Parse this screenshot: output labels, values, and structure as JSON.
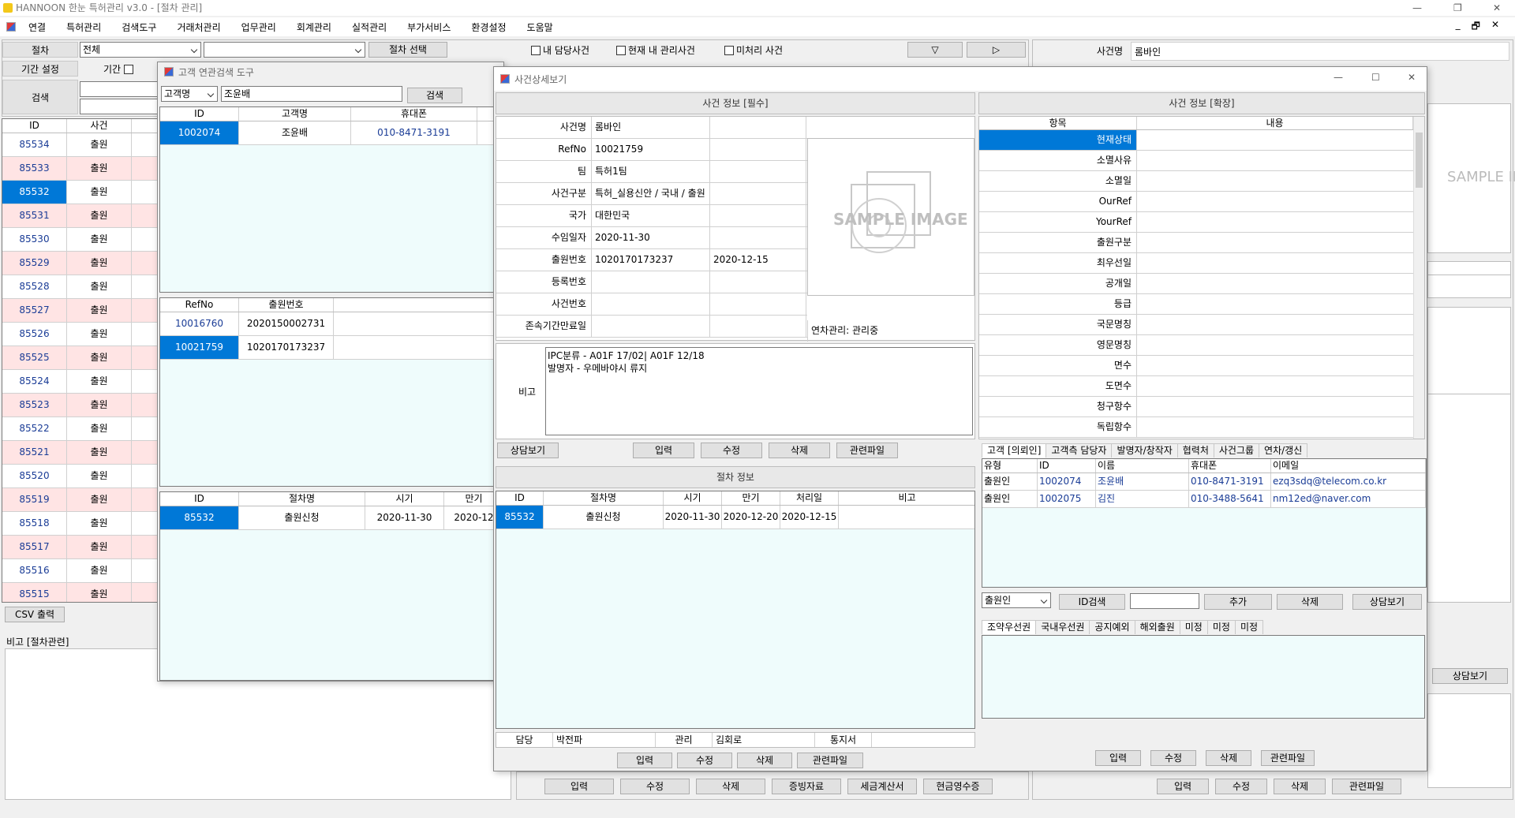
{
  "app": {
    "title": "HANNOON 한눈 특허관리 v3.0 - [절차 관리]",
    "win_min": "—",
    "win_max": "❐",
    "win_close": "✕"
  },
  "menu": [
    "연결",
    "특허관리",
    "검색도구",
    "거래처관리",
    "업무관리",
    "회계관리",
    "실적관리",
    "부가서비스",
    "환경설정",
    "도움말"
  ],
  "mdi_controls": [
    "_",
    "🗗",
    "✕"
  ],
  "filter": {
    "proc_label": "절차",
    "proc_value": "전체",
    "proc_select_btn": "절차 선택",
    "chk_mine": "내 담당사건",
    "chk_current": "현재 내 관리사건",
    "chk_unproc": "미처리 사건",
    "period_label": "기간 설정",
    "period_chk": "기간",
    "search_label": "검색",
    "nav_down": "▽",
    "nav_right": "▷"
  },
  "left_grid": {
    "headers": [
      "ID",
      "사건"
    ],
    "rows": [
      [
        "85534",
        "출원"
      ],
      [
        "85533",
        "출원"
      ],
      [
        "85532",
        "출원"
      ],
      [
        "85531",
        "출원"
      ],
      [
        "85530",
        "출원"
      ],
      [
        "85529",
        "출원"
      ],
      [
        "85528",
        "출원"
      ],
      [
        "85527",
        "출원"
      ],
      [
        "85526",
        "출원"
      ],
      [
        "85525",
        "출원"
      ],
      [
        "85524",
        "출원"
      ],
      [
        "85523",
        "출원"
      ],
      [
        "85522",
        "출원"
      ],
      [
        "85521",
        "출원"
      ],
      [
        "85520",
        "출원"
      ],
      [
        "85519",
        "출원"
      ],
      [
        "85518",
        "출원"
      ],
      [
        "85517",
        "출원"
      ],
      [
        "85516",
        "출원"
      ],
      [
        "85515",
        "출원"
      ]
    ],
    "csv_btn": "CSV 출력",
    "memo_label": "비고 [절차관련]"
  },
  "bottom_buttons": [
    "입력",
    "수정",
    "삭제",
    "증빙자료",
    "세금계산서",
    "현금영수증"
  ],
  "right_panel": {
    "case_name_label": "사건명",
    "case_name": "롬바인",
    "consult_btn": "상담보기",
    "bottom_buttons": [
      "입력",
      "수정",
      "삭제",
      "관련파일"
    ],
    "sample": "SAMPLE IMAGE"
  },
  "cust_tool": {
    "title": "고객 연관검색 도구",
    "search_type": "고객명",
    "search_value": "조윤배",
    "search_btn": "검색",
    "grid1": {
      "headers": [
        "ID",
        "고객명",
        "휴대폰"
      ],
      "rows": [
        [
          "1002074",
          "조윤배",
          "010-8471-3191"
        ]
      ]
    },
    "grid2": {
      "headers": [
        "RefNo",
        "출원번호"
      ],
      "rows": [
        [
          "10016760",
          "2020150002731"
        ],
        [
          "10021759",
          "1020170173237"
        ]
      ]
    },
    "grid3": {
      "headers": [
        "ID",
        "절차명",
        "시기",
        "만기"
      ],
      "rows": [
        [
          "85532",
          "출원신청",
          "2020-11-30",
          "2020-12"
        ]
      ]
    }
  },
  "detail": {
    "title": "사건상세보기",
    "req_header": "사건 정보 [필수]",
    "fields": [
      {
        "label": "사건명",
        "value": "롬바인",
        "value2": ""
      },
      {
        "label": "RefNo",
        "value": "10021759",
        "value2": ""
      },
      {
        "label": "팀",
        "value": "특허1팀",
        "value2": ""
      },
      {
        "label": "사건구분",
        "value": "특허_실용신안 / 국내 / 출원",
        "value2": ""
      },
      {
        "label": "국가",
        "value": "대한민국",
        "value2": ""
      },
      {
        "label": "수임일자",
        "value": "2020-11-30",
        "value2": ""
      },
      {
        "label": "출원번호",
        "value": "1020170173237",
        "value2": "2020-12-15"
      },
      {
        "label": "등록번호",
        "value": "",
        "value2": ""
      },
      {
        "label": "사건번호",
        "value": "",
        "value2": ""
      },
      {
        "label": "존속기간만료일",
        "value": "",
        "value2": ""
      }
    ],
    "annuity": "연차관리: 관리중",
    "sample": "SAMPLE IMAGE",
    "memo_label": "비고",
    "memo_lines": [
      "IPC분류 - A01F 17/02| A01F 12/18",
      "발명자 - 우메바야시 류지"
    ],
    "btns1": [
      "상담보기",
      "입력",
      "수정",
      "삭제",
      "관련파일"
    ],
    "proc_header": "절차 정보",
    "proc_grid": {
      "headers": [
        "ID",
        "절차명",
        "시기",
        "만기",
        "처리일",
        "비고"
      ],
      "rows": [
        [
          "85532",
          "출원신청",
          "2020-11-30",
          "2020-12-20",
          "2020-12-15",
          ""
        ]
      ]
    },
    "footer": {
      "owner_label": "담당",
      "owner": "박전파",
      "mgr_label": "관리",
      "mgr": "김회로",
      "notice": "통지서"
    },
    "btns2": [
      "입력",
      "수정",
      "삭제",
      "관련파일"
    ],
    "ext_header": "사건 정보 [확장]",
    "ext_cols": [
      "항목",
      "내용"
    ],
    "ext_rows": [
      "현재상태",
      "소멸사유",
      "소멸일",
      "OurRef",
      "YourRef",
      "출원구분",
      "최우선일",
      "공개일",
      "등급",
      "국문명칭",
      "영문명칭",
      "면수",
      "도면수",
      "청구항수",
      "독립항수"
    ],
    "tabs1": [
      "고객 [의뢰인]",
      "고객측 담당자",
      "발명자/창작자",
      "협력처",
      "사건그룹",
      "연차/갱신"
    ],
    "cust_grid": {
      "headers": [
        "유형",
        "ID",
        "이름",
        "휴대폰",
        "이메일"
      ],
      "rows": [
        [
          "출원인",
          "1002074",
          "조윤배",
          "010-8471-3191",
          "ezq3sdq@telecom.co.kr"
        ],
        [
          "출원인",
          "1002075",
          "김진",
          "010-3488-5641",
          "nm12ed@naver.com"
        ]
      ]
    },
    "cust_type": "출원인",
    "cust_btns": [
      "ID검색",
      "추가",
      "삭제",
      "상담보기"
    ],
    "tabs2": [
      "조약우선권",
      "국내우선권",
      "공지예외",
      "해외출원",
      "미정",
      "미정",
      "미정"
    ],
    "btns3": [
      "입력",
      "수정",
      "삭제",
      "관련파일"
    ]
  }
}
